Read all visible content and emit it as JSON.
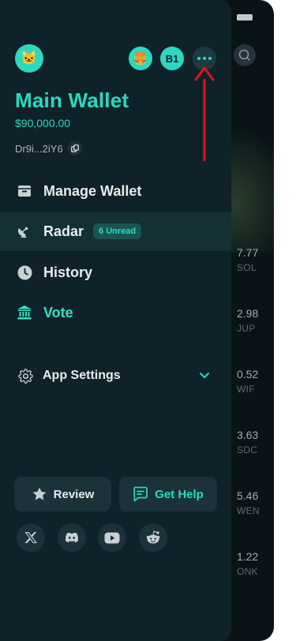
{
  "background": {
    "rows": [
      {
        "amount": "7.77",
        "token": "SOL"
      },
      {
        "amount": "2.98",
        "token": "JUP"
      },
      {
        "amount": "0.52",
        "token": "WIF"
      },
      {
        "amount": "3.63",
        "token": "SDC"
      },
      {
        "amount": "5.46",
        "token": "WEN"
      },
      {
        "amount": "1.22",
        "token": "ONK"
      }
    ]
  },
  "header": {
    "avatar_glyph": "🐱",
    "burger_glyph": "🍔",
    "badge_label": "B1"
  },
  "wallet": {
    "name": "Main Wallet",
    "balance": "$90,000.00",
    "address": "Dr9i...2iY6"
  },
  "menu": {
    "manage": "Manage Wallet",
    "radar": "Radar",
    "radar_badge": "6 Unread",
    "history": "History",
    "vote": "Vote",
    "settings": "App Settings"
  },
  "actions": {
    "review": "Review",
    "help": "Get Help"
  },
  "colors": {
    "accent": "#2ad9c0",
    "drawer_bg": "#0f2229",
    "annotation": "#e0141c"
  },
  "icons": [
    "wallet-icon",
    "satellite-dish-icon",
    "clock-icon",
    "bank-icon",
    "gear-icon",
    "chevron-down-icon",
    "star-icon",
    "chat-help-icon",
    "x-logo-icon",
    "discord-icon",
    "youtube-icon",
    "reddit-icon",
    "copy-icon",
    "more-dots-icon"
  ]
}
